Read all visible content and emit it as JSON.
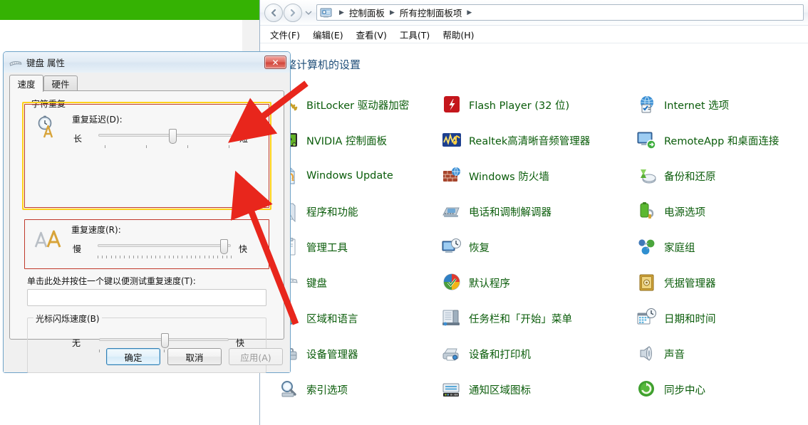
{
  "colors": {
    "green_strip": "#35b203",
    "cp_link": "#0a5c0a",
    "heading": "#1f4e79",
    "highlight_yellow": "#ffd11a",
    "highlight_red": "#c0392b",
    "arrow_red": "#e8261c"
  },
  "explorer": {
    "nav": {
      "back_icon": "back-arrow-icon",
      "forward_icon": "forward-arrow-icon",
      "recent_icon": "chevron-down-icon",
      "address_icon": "control-panel-icon",
      "breadcrumbs": [
        "控制面板",
        "所有控制面板项"
      ],
      "separator": "▶"
    },
    "menus": [
      {
        "label": "文件(F)",
        "name": "menu-file"
      },
      {
        "label": "编辑(E)",
        "name": "menu-edit"
      },
      {
        "label": "查看(V)",
        "name": "menu-view"
      },
      {
        "label": "工具(T)",
        "name": "menu-tools"
      },
      {
        "label": "帮助(H)",
        "name": "menu-help"
      }
    ],
    "heading": "整计算机的设置",
    "items": [
      {
        "label": "BitLocker 驱动器加密",
        "icon": "bitlocker-icon"
      },
      {
        "label": "Flash Player (32 位)",
        "icon": "flash-player-icon"
      },
      {
        "label": "Internet 选项",
        "icon": "internet-options-icon"
      },
      {
        "label": "NVIDIA 控制面板",
        "icon": "nvidia-icon"
      },
      {
        "label": "Realtek高清晰音频管理器",
        "icon": "realtek-audio-icon"
      },
      {
        "label": "RemoteApp 和桌面连接",
        "icon": "remoteapp-icon"
      },
      {
        "label": "Windows Update",
        "icon": "windows-update-icon"
      },
      {
        "label": "Windows 防火墙",
        "icon": "firewall-icon"
      },
      {
        "label": "备份和还原",
        "icon": "backup-restore-icon"
      },
      {
        "label": "程序和功能",
        "icon": "programs-features-icon"
      },
      {
        "label": "电话和调制解调器",
        "icon": "phone-modem-icon"
      },
      {
        "label": "电源选项",
        "icon": "power-options-icon"
      },
      {
        "label": "管理工具",
        "icon": "admin-tools-icon"
      },
      {
        "label": "恢复",
        "icon": "recovery-icon"
      },
      {
        "label": "家庭组",
        "icon": "homegroup-icon"
      },
      {
        "label": "键盘",
        "icon": "keyboard-icon"
      },
      {
        "label": "默认程序",
        "icon": "default-programs-icon"
      },
      {
        "label": "凭据管理器",
        "icon": "credential-manager-icon"
      },
      {
        "label": "区域和语言",
        "icon": "region-language-icon"
      },
      {
        "label": "任务栏和「开始」菜单",
        "icon": "taskbar-startmenu-icon"
      },
      {
        "label": "日期和时间",
        "icon": "date-time-icon"
      },
      {
        "label": "设备管理器",
        "icon": "device-manager-icon"
      },
      {
        "label": "设备和打印机",
        "icon": "devices-printers-icon"
      },
      {
        "label": "声音",
        "icon": "sound-icon"
      },
      {
        "label": "索引选项",
        "icon": "indexing-options-icon"
      },
      {
        "label": "通知区域图标",
        "icon": "notification-icons-icon"
      },
      {
        "label": "同步中心",
        "icon": "sync-center-icon"
      }
    ]
  },
  "dialog": {
    "title": "键盘 属性",
    "title_icon": "keyboard-icon",
    "close_label": "✕",
    "tabs": [
      {
        "label": "速度",
        "active": true
      },
      {
        "label": "硬件",
        "active": false
      }
    ],
    "group_char_repeat": {
      "title": "字符重复",
      "repeat_delay": {
        "label": "重复延迟(D):",
        "icon": "stopwatch-letter-icon",
        "min_label": "长",
        "max_label": "短",
        "value_position_percent": 58,
        "tick_count": 4
      },
      "repeat_rate": {
        "label": "重复速度(R):",
        "icon": "double-a-icon",
        "min_label": "慢",
        "max_label": "快",
        "value_position_percent": 94,
        "tick_count": 31
      }
    },
    "test_field": {
      "label": "单击此处并按住一个键以便测试重复速度(T):",
      "value": "",
      "placeholder": ""
    },
    "group_cursor_blink": {
      "title": "光标闪烁速度(B)",
      "min_label": "无",
      "max_label": "快",
      "value_position_percent": 52,
      "tick_count": 11
    },
    "buttons": [
      {
        "label": "确定",
        "style": "default",
        "name": "ok-button"
      },
      {
        "label": "取消",
        "style": "normal",
        "name": "cancel-button"
      },
      {
        "label": "应用(A)",
        "style": "disabled",
        "name": "apply-button"
      }
    ]
  },
  "annotations": [
    {
      "name": "arrow-to-repeat-delay-group",
      "kind": "red-arrow"
    },
    {
      "name": "arrow-to-repeat-rate-group",
      "kind": "red-arrow"
    }
  ]
}
